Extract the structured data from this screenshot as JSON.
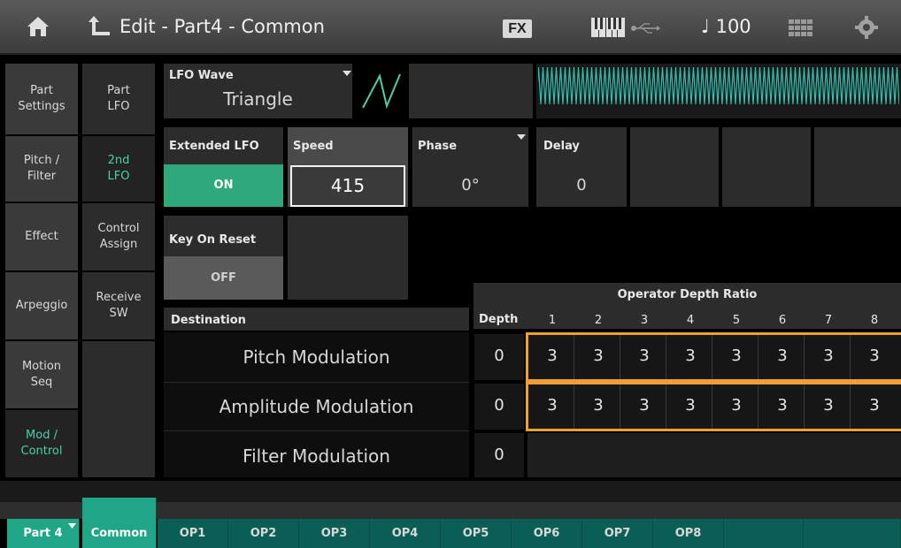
{
  "topbar": {
    "title": "Edit - Part4 - Common",
    "fx_badge": "FX",
    "tempo": "♩ 100",
    "icons": [
      "home-icon",
      "back-arrow-icon",
      "keyboard-icon",
      "usb-icon",
      "grid-icon",
      "gear-icon"
    ]
  },
  "left_tabs": {
    "col1": [
      "Part Settings",
      "Pitch / Filter",
      "Effect",
      "Arpeggio",
      "Motion Seq",
      "Mod / Control"
    ],
    "col2": [
      "Part LFO",
      "2nd LFO",
      "Control Assign",
      "Receive SW",
      ""
    ]
  },
  "lfo_wave": {
    "label": "LFO Wave",
    "value": "Triangle"
  },
  "extended_lfo": {
    "label": "Extended LFO",
    "value": "ON"
  },
  "speed": {
    "label": "Speed",
    "value": "415"
  },
  "phase": {
    "label": "Phase",
    "value": "0°"
  },
  "delay": {
    "label": "Delay",
    "value": "0"
  },
  "key_on_reset": {
    "label": "Key On Reset",
    "value": "OFF"
  },
  "destination": {
    "header": "Destination",
    "depth_header": "Depth",
    "odr_header": "Operator Depth Ratio",
    "op_numbers": [
      "1",
      "2",
      "3",
      "4",
      "5",
      "6",
      "7",
      "8"
    ],
    "rows": [
      {
        "name": "Pitch Modulation",
        "depth": "0",
        "ratios": [
          "3",
          "3",
          "3",
          "3",
          "3",
          "3",
          "3",
          "3"
        ]
      },
      {
        "name": "Amplitude Modulation",
        "depth": "0",
        "ratios": [
          "3",
          "3",
          "3",
          "3",
          "3",
          "3",
          "3",
          "3"
        ]
      },
      {
        "name": "Filter Modulation",
        "depth": "0"
      }
    ]
  },
  "bottom_tabs": [
    "Part 4",
    "Common",
    "OP1",
    "OP2",
    "OP3",
    "OP4",
    "OP5",
    "OP6",
    "OP7",
    "OP8"
  ],
  "colors": {
    "accent": "#48d1a8",
    "highlight": "#f0a030",
    "on_button": "#2fa97c",
    "tab_bg": "#0a5e55"
  }
}
